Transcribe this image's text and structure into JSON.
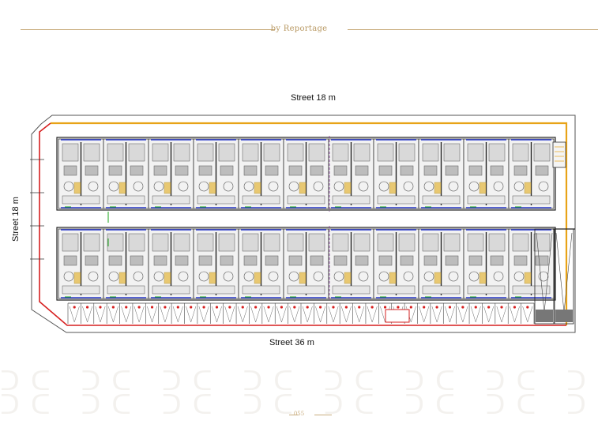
{
  "header": {
    "brand": "by Reportage"
  },
  "footer": {
    "page_number": "055"
  },
  "plan": {
    "street_top": "Street 18 m",
    "street_left": "Street 18 m",
    "street_bottom": "Street 36 m",
    "colors": {
      "boundary_yellow": "#e8a317",
      "boundary_red": "#d61f1f",
      "wall_blue": "#2f3fcf",
      "green": "#1aa51a",
      "accent_gold": "#c9ad7f"
    },
    "rows": 2,
    "units_per_row": 11,
    "parking_bays": 36
  }
}
